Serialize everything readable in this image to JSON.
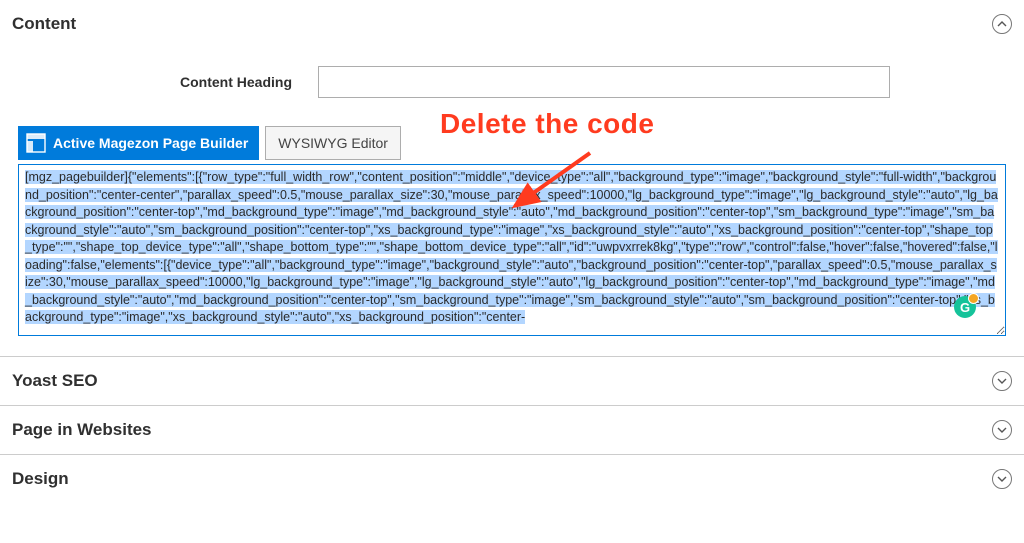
{
  "annotation": {
    "text": "Delete the code"
  },
  "sections": {
    "content": {
      "title": "Content"
    },
    "yoast": {
      "title": "Yoast SEO"
    },
    "pagesites": {
      "title": "Page in Websites"
    },
    "design": {
      "title": "Design"
    }
  },
  "contentPanel": {
    "headingLabel": "Content Heading",
    "headingValue": "",
    "activeBuilderLabel": "Active Magezon Page Builder",
    "wysiwygLabel": "WYSIWYG Editor",
    "codeText": "[mgz_pagebuilder]{\"elements\":[{\"row_type\":\"full_width_row\",\"content_position\":\"middle\",\"device_type\":\"all\",\"background_type\":\"image\",\"background_style\":\"full-width\",\"background_position\":\"center-center\",\"parallax_speed\":0.5,\"mouse_parallax_size\":30,\"mouse_parallax_speed\":10000,\"lg_background_type\":\"image\",\"lg_background_style\":\"auto\",\"lg_background_position\":\"center-top\",\"md_background_type\":\"image\",\"md_background_style\":\"auto\",\"md_background_position\":\"center-top\",\"sm_background_type\":\"image\",\"sm_background_style\":\"auto\",\"sm_background_position\":\"center-top\",\"xs_background_type\":\"image\",\"xs_background_style\":\"auto\",\"xs_background_position\":\"center-top\",\"shape_top_type\":\"\",\"shape_top_device_type\":\"all\",\"shape_bottom_type\":\"\",\"shape_bottom_device_type\":\"all\",\"id\":\"uwpvxrrek8kg\",\"type\":\"row\",\"control\":false,\"hover\":false,\"hovered\":false,\"loading\":false,\"elements\":[{\"device_type\":\"all\",\"background_type\":\"image\",\"background_style\":\"auto\",\"background_position\":\"center-top\",\"parallax_speed\":0.5,\"mouse_parallax_size\":30,\"mouse_parallax_speed\":10000,\"lg_background_type\":\"image\",\"lg_background_style\":\"auto\",\"lg_background_position\":\"center-top\",\"md_background_type\":\"image\",\"md_background_style\":\"auto\",\"md_background_position\":\"center-top\",\"sm_background_type\":\"image\",\"sm_background_style\":\"auto\",\"sm_background_position\":\"center-top\",\"xs_background_type\":\"image\",\"xs_background_style\":\"auto\",\"xs_background_position\":\"center-"
  },
  "grammarly": {
    "letter": "G"
  }
}
